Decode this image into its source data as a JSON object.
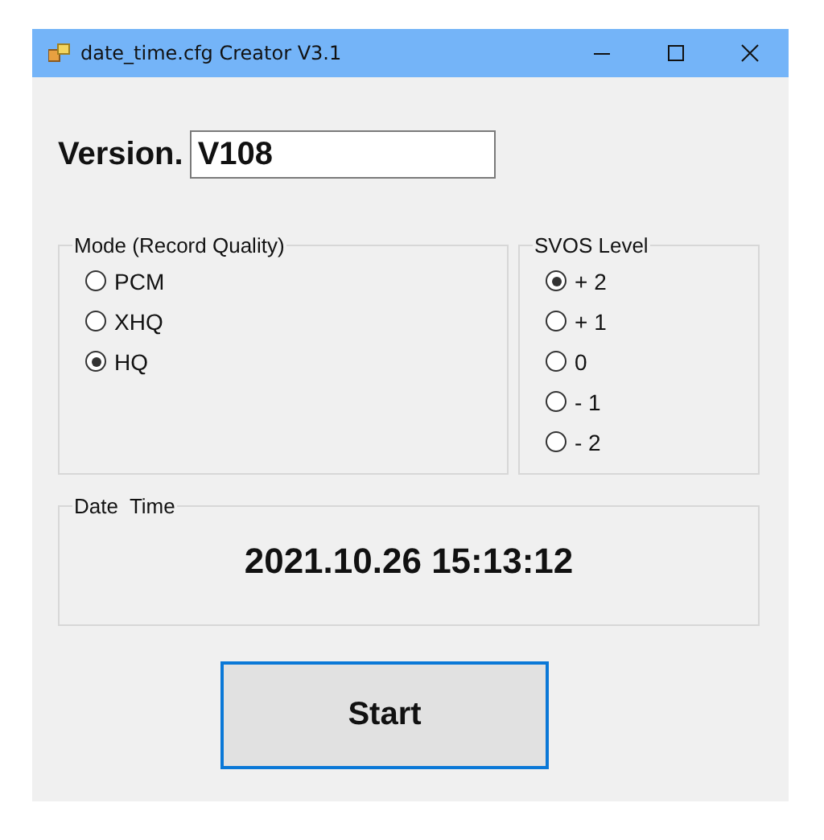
{
  "window": {
    "title": "date_time.cfg Creator V3.1"
  },
  "version": {
    "label": "Version.",
    "value": "V108"
  },
  "mode_group": {
    "title": "Mode (Record Quality)",
    "options": [
      {
        "label": "PCM",
        "selected": false
      },
      {
        "label": "XHQ",
        "selected": false
      },
      {
        "label": "HQ",
        "selected": true
      }
    ]
  },
  "svos_group": {
    "title": "SVOS Level",
    "options": [
      {
        "label": "+ 2",
        "selected": true
      },
      {
        "label": "+ 1",
        "selected": false
      },
      {
        "label": "0",
        "selected": false
      },
      {
        "label": "- 1",
        "selected": false
      },
      {
        "label": "- 2",
        "selected": false
      }
    ]
  },
  "date_time_group": {
    "title": "Date  Time",
    "value": "2021.10.26 15:13:12"
  },
  "buttons": [
    "Start"
  ]
}
